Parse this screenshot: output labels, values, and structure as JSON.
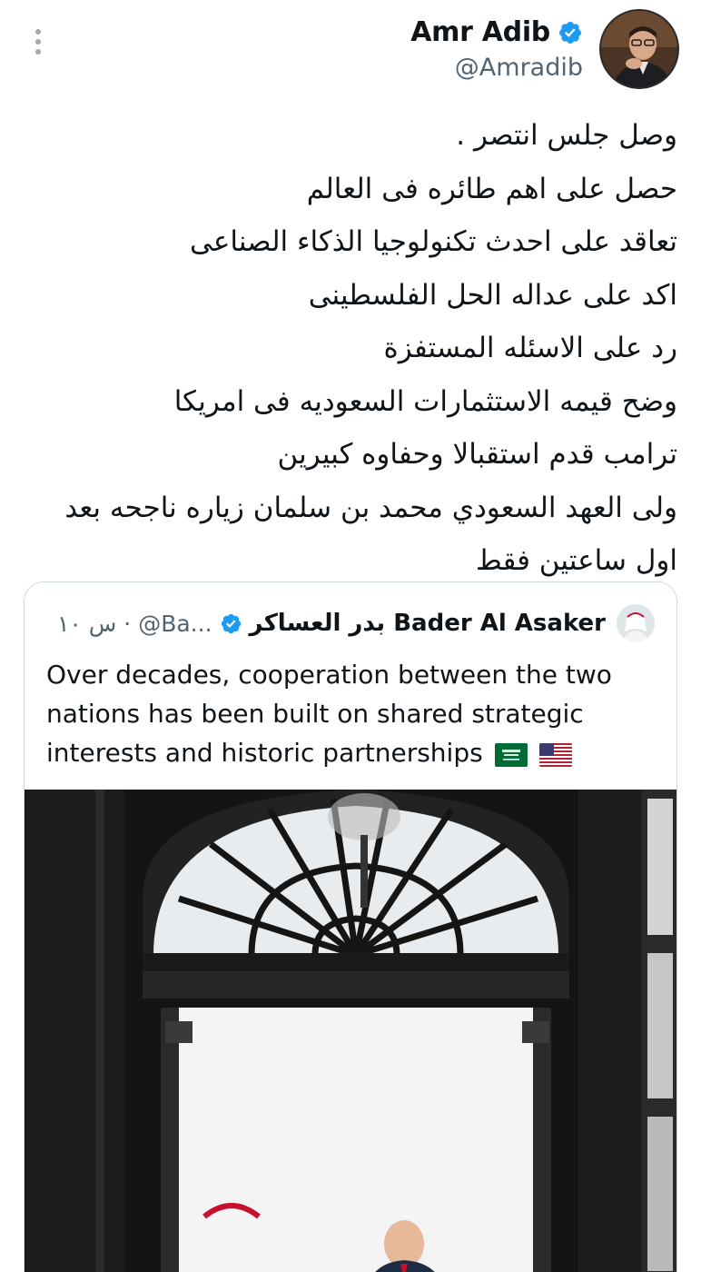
{
  "author": {
    "name": "Amr Adib",
    "handle": "@Amradib"
  },
  "tweet": {
    "lines": [
      "وصل جلس انتصر .",
      "حصل على اهم طائره فى العالم",
      "تعاقد على احدث تكنولوجيا الذكاء الصناعى",
      "اكد على عداله الحل الفلسطينى",
      "رد على الاسئله المستفزة",
      "وضح قيمه الاستثمارات السعوديه فى امريكا",
      "ترامب قدم استقبالا وحفاوه كبيرين",
      "ولى العهد السعودي محمد بن سلمان زياره ناجحه بعد",
      "اول ساعتين فقط"
    ]
  },
  "quote": {
    "name": "بدر العساكر Bader Al Asaker",
    "handle": "@Ba...",
    "time": "۱۰ س ·",
    "text": "Over decades, cooperation between the two nations has been built on shared strategic interests and historic partnerships"
  },
  "colors": {
    "verified": "#1d9bf0",
    "text": "#0f1419",
    "secondary": "#536471",
    "border": "#cfd9de"
  },
  "icons": {
    "more": "vertical-ellipsis-icon",
    "verified": "verified-badge-icon",
    "flags": [
      "saudi-flag-icon",
      "us-flag-icon"
    ]
  }
}
